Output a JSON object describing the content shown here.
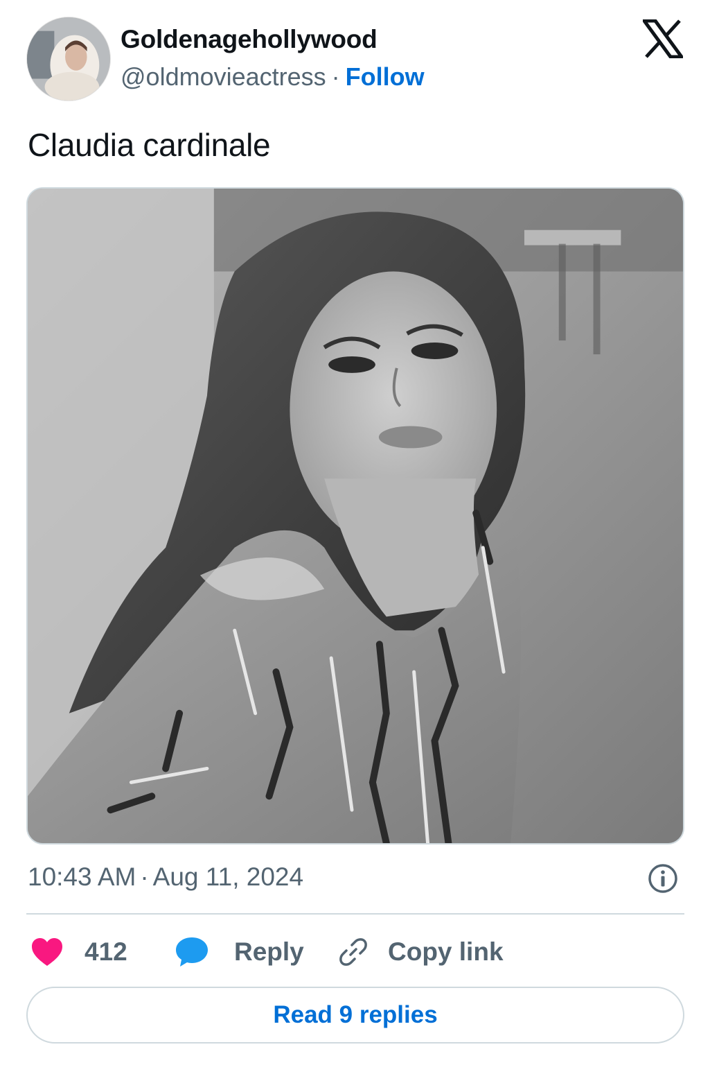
{
  "author": {
    "display_name": "Goldenagehollywood",
    "handle": "@oldmovieactress",
    "separator": "·",
    "follow_label": "Follow"
  },
  "tweet": {
    "text": "Claudia cardinale",
    "time": "10:43 AM",
    "separator": "·",
    "date": "Aug 11, 2024"
  },
  "actions": {
    "like_count": "412",
    "reply_label": "Reply",
    "copy_link_label": "Copy link"
  },
  "read_replies_label": "Read 9 replies",
  "icons": {
    "brand": "x-logo-icon",
    "info": "info-icon",
    "like": "heart-icon",
    "reply": "speech-bubble-icon",
    "copy": "link-icon"
  },
  "colors": {
    "accent": "#006fd6",
    "like": "#f91880",
    "reply": "#1d9bf0",
    "muted": "#536471",
    "text": "#0f1419",
    "border": "#cfd9de"
  }
}
